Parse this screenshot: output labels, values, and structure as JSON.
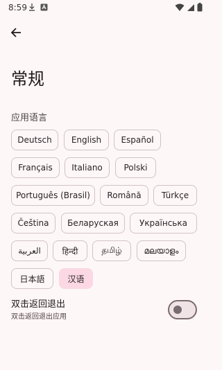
{
  "status_bar": {
    "time": "8:59",
    "left_icons": [
      "download-icon",
      "translate-icon"
    ],
    "right_icons": [
      "wifi-icon",
      "cellular-icon",
      "battery-icon"
    ]
  },
  "header": {
    "back_icon": "arrow-back-icon",
    "title": "常规"
  },
  "language_section": {
    "label": "应用语言",
    "languages": [
      "Deutsch",
      "English",
      "Español",
      "Français",
      "Italiano",
      "Polski",
      "Português (Brasil)",
      "Română",
      "Türkçe",
      "Čeština",
      "Беларуская",
      "Українська",
      "العربية",
      "हिन्दी",
      "தமிழ்",
      "മലയാളം",
      "日本語",
      "汉语"
    ],
    "selected": "汉语"
  },
  "double_back_exit": {
    "title": "双击返回退出",
    "subtitle": "双击返回退出应用",
    "enabled": false
  },
  "colors": {
    "background": "#fef7f8",
    "chip_border": "#cfc3c6",
    "selected_chip": "#fbd8e3",
    "switch_outline": "#7a6b70"
  }
}
